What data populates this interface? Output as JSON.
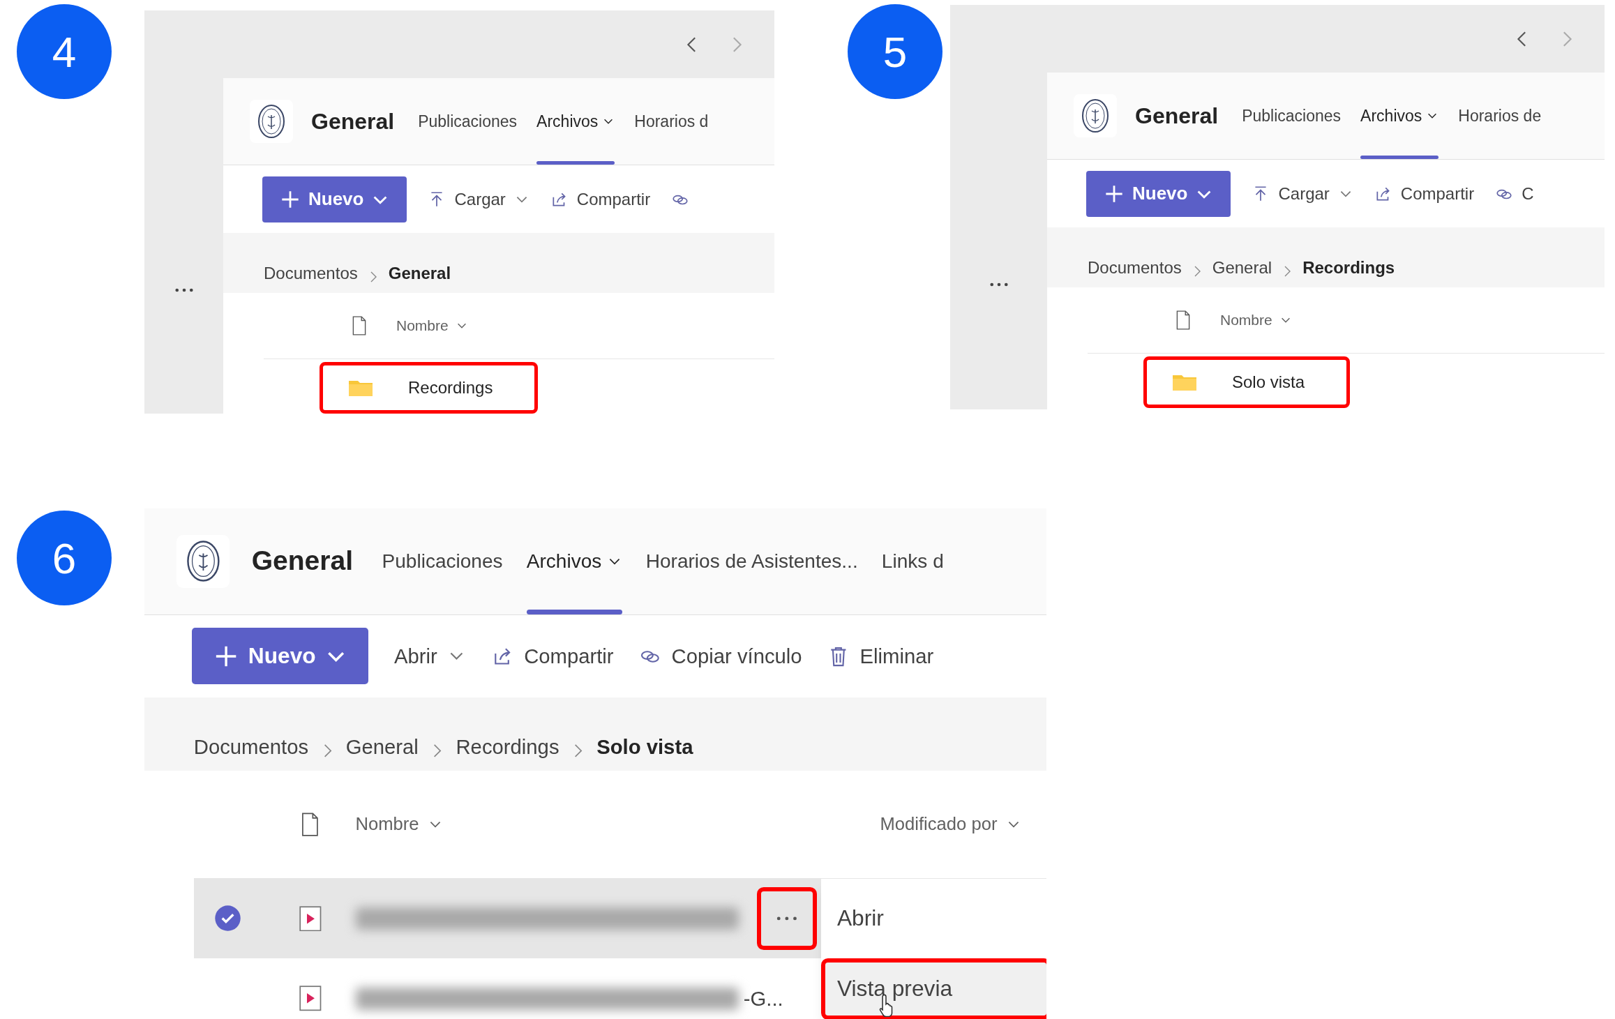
{
  "steps": [
    {
      "number": "4",
      "channel": {
        "title": "General",
        "tabs": [
          {
            "label": "Publicaciones",
            "selected": false,
            "menu": false
          },
          {
            "label": "Archivos",
            "selected": true,
            "menu": true
          },
          {
            "label": "Horarios d",
            "selected": false,
            "menu": false
          }
        ]
      },
      "toolbar": {
        "new_button": "Nuevo",
        "actions": [
          {
            "kind": "upload",
            "label": "Cargar",
            "menu": true
          },
          {
            "kind": "share",
            "label": "Compartir",
            "menu": false
          },
          {
            "kind": "link",
            "menu": false
          }
        ]
      },
      "breadcrumb": [
        {
          "label": "Documentos",
          "current": false
        },
        {
          "label": "General",
          "current": true
        }
      ],
      "columns": [
        "Nombre"
      ],
      "rows": [
        {
          "kind": "folder",
          "name": "Recordings",
          "highlighted": true
        }
      ]
    },
    {
      "number": "5",
      "channel": {
        "title": "General",
        "tabs": [
          {
            "label": "Publicaciones",
            "selected": false,
            "menu": false
          },
          {
            "label": "Archivos",
            "selected": true,
            "menu": true
          },
          {
            "label": "Horarios de",
            "selected": false,
            "menu": false
          }
        ]
      },
      "toolbar": {
        "new_button": "Nuevo",
        "actions": [
          {
            "kind": "upload",
            "label": "Cargar",
            "menu": true
          },
          {
            "kind": "share",
            "label": "Compartir",
            "menu": false
          },
          {
            "kind": "link",
            "label": "C",
            "menu": false
          }
        ]
      },
      "breadcrumb": [
        {
          "label": "Documentos",
          "current": false
        },
        {
          "label": "General",
          "current": false
        },
        {
          "label": "Recordings",
          "current": true
        }
      ],
      "columns": [
        "Nombre"
      ],
      "rows": [
        {
          "kind": "folder",
          "name": "Solo vista",
          "highlighted": true
        }
      ]
    },
    {
      "number": "6",
      "channel": {
        "title": "General",
        "tabs": [
          {
            "label": "Publicaciones",
            "selected": false,
            "menu": false
          },
          {
            "label": "Archivos",
            "selected": true,
            "menu": true
          },
          {
            "label": "Horarios de Asistentes...",
            "selected": false,
            "menu": false
          },
          {
            "label": "Links d",
            "selected": false,
            "menu": false
          }
        ]
      },
      "toolbar": {
        "new_button": "Nuevo",
        "actions": [
          {
            "kind": "open",
            "label": "Abrir",
            "menu": true
          },
          {
            "kind": "share",
            "label": "Compartir",
            "menu": false
          },
          {
            "kind": "link",
            "label": "Copiar vínculo",
            "menu": false
          },
          {
            "kind": "delete",
            "label": "Eliminar",
            "menu": false
          }
        ]
      },
      "breadcrumb": [
        {
          "label": "Documentos",
          "current": false
        },
        {
          "label": "General",
          "current": false
        },
        {
          "label": "Recordings",
          "current": false
        },
        {
          "label": "Solo vista",
          "current": true
        }
      ],
      "columns": [
        "Nombre",
        "Modificado por"
      ],
      "rows": [
        {
          "kind": "video",
          "selected": true,
          "more_highlighted": true
        },
        {
          "kind": "video",
          "selected": false,
          "tail": "-G..."
        }
      ],
      "context_menu": [
        {
          "label": "Abrir",
          "highlighted": false
        },
        {
          "label": "Vista previa",
          "highlighted": true
        }
      ]
    }
  ]
}
